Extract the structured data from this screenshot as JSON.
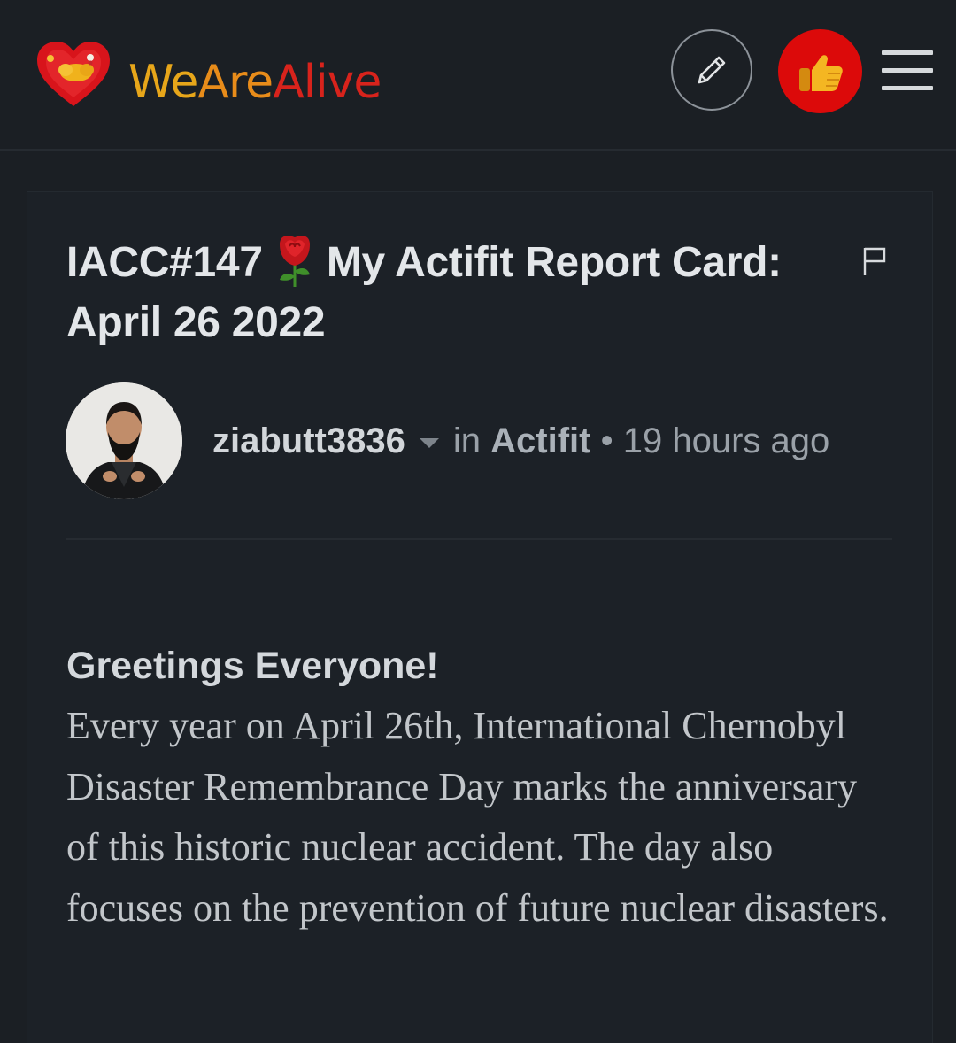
{
  "header": {
    "brand": {
      "part1": "We",
      "part2": "Are",
      "part3": "Alive"
    },
    "icons": {
      "logo": "heart-logo-icon",
      "edit": "pencil-icon",
      "vote": "thumbs-up-icon",
      "menu": "hamburger-menu-icon"
    },
    "colors": {
      "vote_bg": "#dc0a0a",
      "brand_yellow": "#e7a61a",
      "brand_red": "#d8231c"
    }
  },
  "post": {
    "title_prefix": "IACC#147",
    "title_emoji": "rose-icon",
    "title_main": "My Actifit Report Card: April 26 2022",
    "author": "ziabutt3836",
    "community_prefix": "in",
    "community": "Actifit",
    "separator": "•",
    "time": "19 hours ago",
    "greeting": "Greetings Everyone!",
    "body": "Every year on April 26th, International Chernobyl Disaster Remembrance Day marks the anniversary of this historic nuclear accident. The day also focuses on the prevention of future nuclear disasters."
  }
}
